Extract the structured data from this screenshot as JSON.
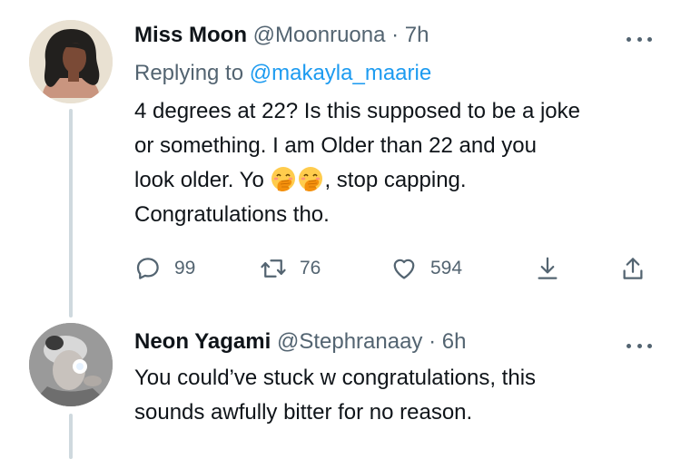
{
  "tweet1": {
    "name": "Miss Moon",
    "handle": "@Moonruona",
    "separator": "·",
    "time": "7h",
    "replying_prefix": "Replying to",
    "replying_to": "@makayla_maarie",
    "text_line1": "4 degrees at 22? Is this supposed to be a joke",
    "text_line2": "or something. I am Older than 22 and you",
    "text_line3a": "look older. Yo",
    "text_line3b": ", stop capping.",
    "text_line4": "Congratulations tho.",
    "replies": "99",
    "retweets": "76",
    "likes": "594"
  },
  "tweet2": {
    "name": "Neon Yagami",
    "handle": "@Stephranaay",
    "separator": "·",
    "time": "6h",
    "text_line1": "You could’ve stuck w congratulations, this",
    "text_line2": "sounds awfully bitter for no reason."
  },
  "colors": {
    "link": "#1d9bf0",
    "muted": "#536471",
    "text": "#0f1419",
    "thread_line": "#cfd9de"
  },
  "icons": [
    "more-icon",
    "reply-icon",
    "retweet-icon",
    "like-icon",
    "bookmark-icon",
    "share-icon",
    "hand-over-mouth-emoji"
  ]
}
